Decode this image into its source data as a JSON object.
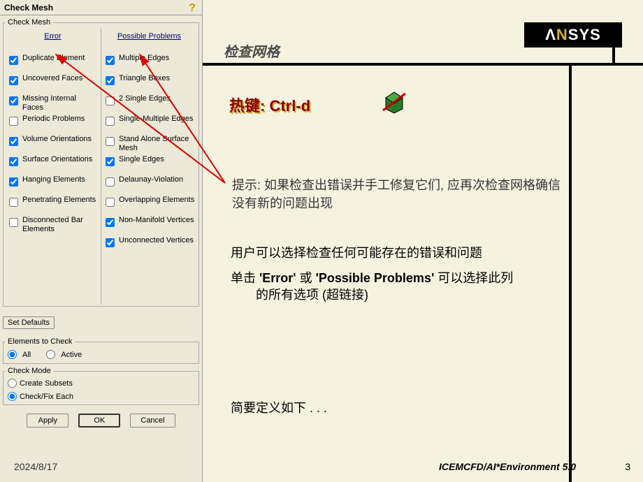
{
  "panel": {
    "title": "Check Mesh",
    "help_icon": "?",
    "fieldset_label": "Check Mesh",
    "error_header": "Error",
    "problems_header": "Possible Problems",
    "error_items": [
      {
        "label": "Duplicate Element",
        "checked": true
      },
      {
        "label": "Uncovered Faces",
        "checked": true
      },
      {
        "label": "Missing Internal Faces",
        "checked": true
      },
      {
        "label": "Periodic Problems",
        "checked": false
      },
      {
        "label": "Volume Orientations",
        "checked": true
      },
      {
        "label": "Surface Orientations",
        "checked": true
      },
      {
        "label": "Hanging Elements",
        "checked": true
      },
      {
        "label": "Penetrating Elements",
        "checked": false
      },
      {
        "label": "Disconnected Bar Elements",
        "checked": false
      }
    ],
    "problem_items": [
      {
        "label": "Multiple Edges",
        "checked": true
      },
      {
        "label": "Triangle Boxes",
        "checked": true
      },
      {
        "label": "2 Single Edges",
        "checked": false
      },
      {
        "label": "Single-Multiple Edges",
        "checked": false
      },
      {
        "label": "Stand Alone Surface Mesh",
        "checked": false
      },
      {
        "label": "Single Edges",
        "checked": true
      },
      {
        "label": "Delaunay-Violation",
        "checked": false
      },
      {
        "label": "Overlapping Elements",
        "checked": false
      },
      {
        "label": "Non-Manifold Vertices",
        "checked": true
      },
      {
        "label": "Unconnected Vertices",
        "checked": true
      }
    ],
    "set_defaults": "Set Defaults",
    "elements_to_check": {
      "legend": "Elements to Check",
      "all": "All",
      "active": "Active",
      "selected": "all"
    },
    "check_mode": {
      "legend": "Check Mode",
      "create": "Create Subsets",
      "checkfix": "Check/Fix Each",
      "selected": "checkfix"
    },
    "buttons": {
      "apply": "Apply",
      "ok": "OK",
      "cancel": "Cancel"
    }
  },
  "slide": {
    "logo": {
      "a": "Λ",
      "n": "N",
      "sys": "SYS"
    },
    "title": "检查网格",
    "hotkey": "热键: Ctrl-d",
    "tip": "提示:  如果检查出错误并手工修复它们, 应再次检查网格确信没有新的问题出现",
    "body1": "用户可以选择检查任何可能存在的错误和问题",
    "body2a": "单击 ",
    "body2_error": "'Error'",
    "body2_or": " 或 ",
    "body2_pp": "'Possible Problems'",
    "body2b": " 可以选择此列",
    "body2c": "的所有选项 (超链接)",
    "body3": "简要定义如下 . . .",
    "footer_date": "2024/8/17",
    "footer_center": "ICEMCFD/AI*Environment 5.0",
    "footer_page": "3"
  }
}
